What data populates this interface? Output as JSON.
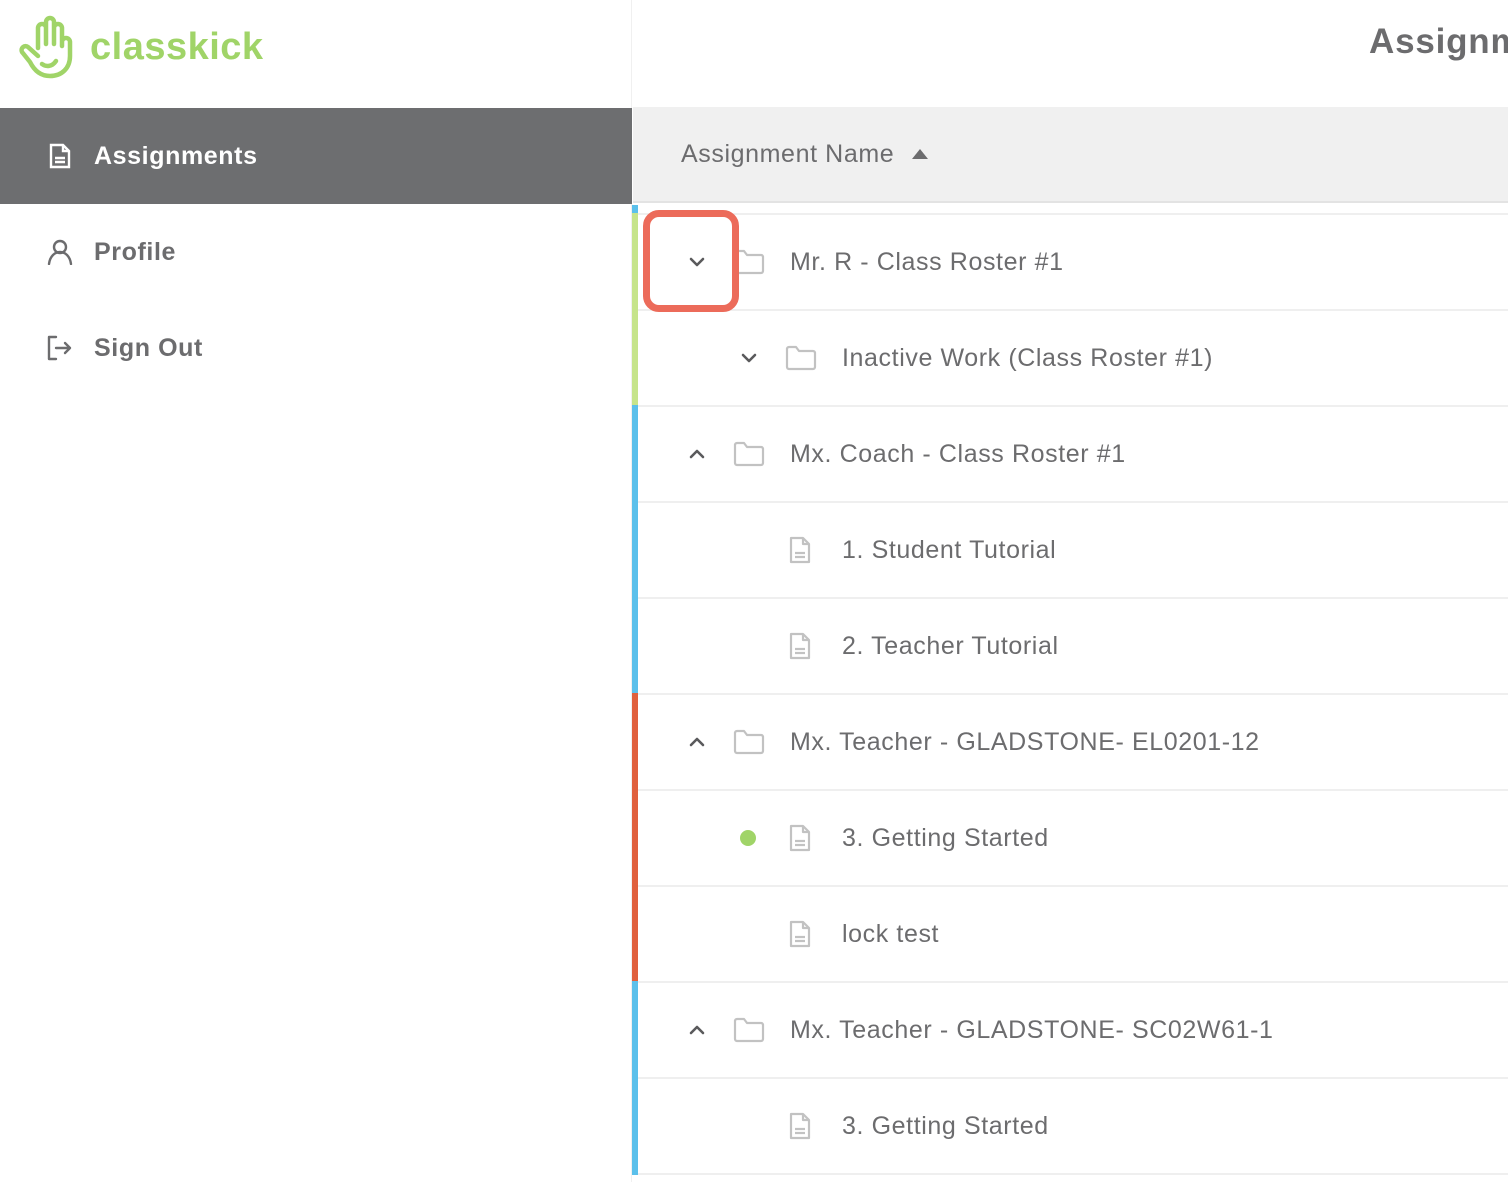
{
  "brand": {
    "name": "classkick",
    "color": "#a0d468",
    "icon": "hand-logo-icon"
  },
  "sidebar": {
    "items": [
      {
        "label": "Assignments",
        "icon": "document-icon",
        "active": true
      },
      {
        "label": "Profile",
        "icon": "user-icon",
        "active": false
      },
      {
        "label": "Sign Out",
        "icon": "sign-out-icon",
        "active": false
      }
    ]
  },
  "header": {
    "title": "Assignments"
  },
  "table": {
    "column_header": "Assignment Name",
    "sort": "ascending",
    "rows": [
      {
        "type": "folder",
        "level": 0,
        "name": "Mr. R - Class Roster #1",
        "chevron": "down",
        "group_color": "#c6e48b"
      },
      {
        "type": "folder",
        "level": 1,
        "name": "Inactive Work (Class Roster #1)",
        "chevron": "down",
        "group_color": "#c6e48b"
      },
      {
        "type": "folder",
        "level": 0,
        "name": "Mx. Coach - Class Roster #1",
        "chevron": "up",
        "group_color": "#5bc0eb"
      },
      {
        "type": "assignment",
        "level": 1,
        "name": "1. Student Tutorial",
        "group_color": "#5bc0eb"
      },
      {
        "type": "assignment",
        "level": 1,
        "name": "2. Teacher Tutorial",
        "group_color": "#5bc0eb"
      },
      {
        "type": "folder",
        "level": 0,
        "name": "Mx. Teacher - GLADSTONE- EL0201-12",
        "chevron": "up",
        "group_color": "#e0603d"
      },
      {
        "type": "assignment",
        "level": 1,
        "name": "3. Getting Started",
        "status_dot": "#a0d468",
        "group_color": "#e0603d"
      },
      {
        "type": "assignment",
        "level": 1,
        "name": "lock test",
        "group_color": "#e0603d"
      },
      {
        "type": "folder",
        "level": 0,
        "name": "Mx. Teacher - GLADSTONE- SC02W61-1",
        "chevron": "up",
        "group_color": "#5bc0eb"
      },
      {
        "type": "assignment",
        "level": 1,
        "name": "3. Getting Started",
        "group_color": "#5bc0eb"
      }
    ]
  },
  "highlight": {
    "target": "expand-collapse-toggle (row 1)",
    "color": "#ec6b5a"
  }
}
